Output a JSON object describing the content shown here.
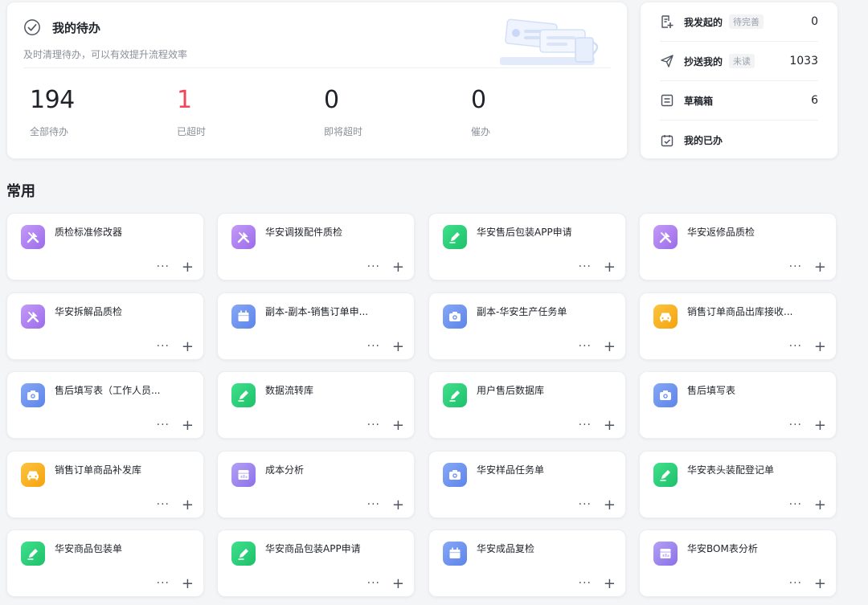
{
  "todo": {
    "title": "我的待办",
    "subtitle": "及时清理待办，可以有效提升流程效率",
    "stats": [
      {
        "value": "194",
        "label": "全部待办",
        "danger": false
      },
      {
        "value": "1",
        "label": "已超时",
        "danger": true
      },
      {
        "value": "0",
        "label": "即将超时",
        "danger": false
      },
      {
        "value": "0",
        "label": "催办",
        "danger": false
      }
    ]
  },
  "side": {
    "items": [
      {
        "label": "我发起的",
        "badge": "待完善",
        "count": "0",
        "icon": "document-plus-icon"
      },
      {
        "label": "抄送我的",
        "badge": "未读",
        "count": "1033",
        "icon": "send-icon"
      },
      {
        "label": "草稿箱",
        "badge": "",
        "count": "6",
        "icon": "draft-icon"
      },
      {
        "label": "我的已办",
        "badge": "",
        "count": "",
        "icon": "calendar-check-icon"
      }
    ]
  },
  "section": {
    "title": "常用"
  },
  "colors": {
    "purple": "#b07cf0",
    "green": "#2fcf7a",
    "blue": "#6f95f0",
    "orange": "#f9b21d",
    "violet": "#9f86ef",
    "danger": "#f0455b"
  },
  "apps": [
    {
      "name": "质检标准修改器",
      "icon": "tools-icon",
      "color": "purple"
    },
    {
      "name": "华安调拨配件质检",
      "icon": "tools-icon",
      "color": "purple"
    },
    {
      "name": "华安售后包装APP申请",
      "icon": "pen-icon",
      "color": "green"
    },
    {
      "name": "华安返修品质检",
      "icon": "tools-icon",
      "color": "purple"
    },
    {
      "name": "华安拆解品质检",
      "icon": "tools-icon",
      "color": "purple"
    },
    {
      "name": "副本-副本-销售订单申...",
      "icon": "calendar-icon",
      "color": "blue"
    },
    {
      "name": "副本-华安生产任务单",
      "icon": "camera-icon",
      "color": "blue"
    },
    {
      "name": "销售订单商品出库接收...",
      "icon": "car-icon",
      "color": "orange"
    },
    {
      "name": "售后填写表（工作人员...",
      "icon": "camera-icon",
      "color": "blue"
    },
    {
      "name": "数据流转库",
      "icon": "pen-icon",
      "color": "green"
    },
    {
      "name": "用户售后数据库",
      "icon": "pen-icon",
      "color": "green"
    },
    {
      "name": "售后填写表",
      "icon": "camera-icon",
      "color": "blue"
    },
    {
      "name": "销售订单商品补发库",
      "icon": "car-icon",
      "color": "orange"
    },
    {
      "name": "成本分析",
      "icon": "chart-icon",
      "color": "violet"
    },
    {
      "name": "华安样品任务单",
      "icon": "camera-icon",
      "color": "blue"
    },
    {
      "name": "华安表头装配登记单",
      "icon": "pen-icon",
      "color": "green"
    },
    {
      "name": "华安商品包装单",
      "icon": "pen-icon",
      "color": "green"
    },
    {
      "name": "华安商品包装APP申请",
      "icon": "pen-icon",
      "color": "green"
    },
    {
      "name": "华安成品复检",
      "icon": "calendar-icon",
      "color": "blue"
    },
    {
      "name": "华安BOM表分析",
      "icon": "chart-icon",
      "color": "violet"
    }
  ],
  "actions": {
    "more": "···",
    "add": "+"
  }
}
